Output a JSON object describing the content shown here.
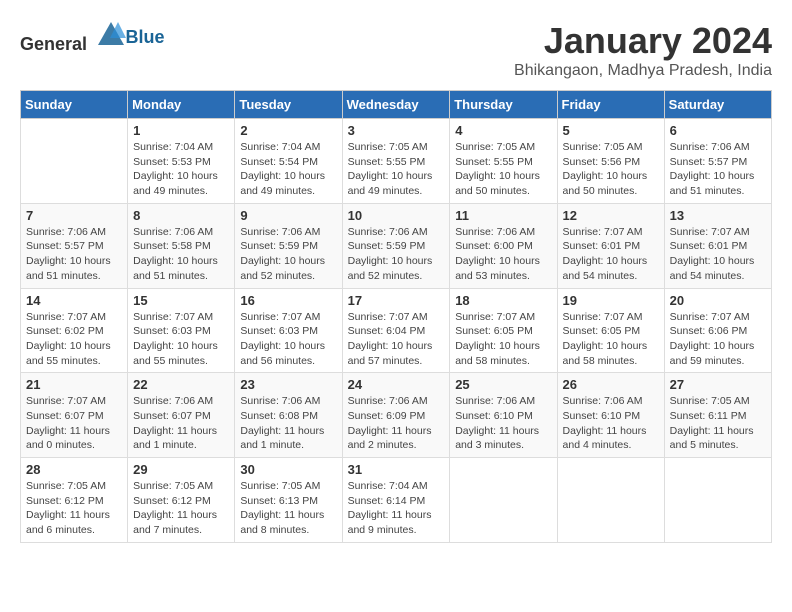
{
  "logo": {
    "general": "General",
    "blue": "Blue"
  },
  "header": {
    "title": "January 2024",
    "subtitle": "Bhikangaon, Madhya Pradesh, India"
  },
  "days_of_week": [
    "Sunday",
    "Monday",
    "Tuesday",
    "Wednesday",
    "Thursday",
    "Friday",
    "Saturday"
  ],
  "weeks": [
    [
      {
        "day": "",
        "info": ""
      },
      {
        "day": "1",
        "info": "Sunrise: 7:04 AM\nSunset: 5:53 PM\nDaylight: 10 hours\nand 49 minutes."
      },
      {
        "day": "2",
        "info": "Sunrise: 7:04 AM\nSunset: 5:54 PM\nDaylight: 10 hours\nand 49 minutes."
      },
      {
        "day": "3",
        "info": "Sunrise: 7:05 AM\nSunset: 5:55 PM\nDaylight: 10 hours\nand 49 minutes."
      },
      {
        "day": "4",
        "info": "Sunrise: 7:05 AM\nSunset: 5:55 PM\nDaylight: 10 hours\nand 50 minutes."
      },
      {
        "day": "5",
        "info": "Sunrise: 7:05 AM\nSunset: 5:56 PM\nDaylight: 10 hours\nand 50 minutes."
      },
      {
        "day": "6",
        "info": "Sunrise: 7:06 AM\nSunset: 5:57 PM\nDaylight: 10 hours\nand 51 minutes."
      }
    ],
    [
      {
        "day": "7",
        "info": "Sunrise: 7:06 AM\nSunset: 5:57 PM\nDaylight: 10 hours\nand 51 minutes."
      },
      {
        "day": "8",
        "info": "Sunrise: 7:06 AM\nSunset: 5:58 PM\nDaylight: 10 hours\nand 51 minutes."
      },
      {
        "day": "9",
        "info": "Sunrise: 7:06 AM\nSunset: 5:59 PM\nDaylight: 10 hours\nand 52 minutes."
      },
      {
        "day": "10",
        "info": "Sunrise: 7:06 AM\nSunset: 5:59 PM\nDaylight: 10 hours\nand 52 minutes."
      },
      {
        "day": "11",
        "info": "Sunrise: 7:06 AM\nSunset: 6:00 PM\nDaylight: 10 hours\nand 53 minutes."
      },
      {
        "day": "12",
        "info": "Sunrise: 7:07 AM\nSunset: 6:01 PM\nDaylight: 10 hours\nand 54 minutes."
      },
      {
        "day": "13",
        "info": "Sunrise: 7:07 AM\nSunset: 6:01 PM\nDaylight: 10 hours\nand 54 minutes."
      }
    ],
    [
      {
        "day": "14",
        "info": "Sunrise: 7:07 AM\nSunset: 6:02 PM\nDaylight: 10 hours\nand 55 minutes."
      },
      {
        "day": "15",
        "info": "Sunrise: 7:07 AM\nSunset: 6:03 PM\nDaylight: 10 hours\nand 55 minutes."
      },
      {
        "day": "16",
        "info": "Sunrise: 7:07 AM\nSunset: 6:03 PM\nDaylight: 10 hours\nand 56 minutes."
      },
      {
        "day": "17",
        "info": "Sunrise: 7:07 AM\nSunset: 6:04 PM\nDaylight: 10 hours\nand 57 minutes."
      },
      {
        "day": "18",
        "info": "Sunrise: 7:07 AM\nSunset: 6:05 PM\nDaylight: 10 hours\nand 58 minutes."
      },
      {
        "day": "19",
        "info": "Sunrise: 7:07 AM\nSunset: 6:05 PM\nDaylight: 10 hours\nand 58 minutes."
      },
      {
        "day": "20",
        "info": "Sunrise: 7:07 AM\nSunset: 6:06 PM\nDaylight: 10 hours\nand 59 minutes."
      }
    ],
    [
      {
        "day": "21",
        "info": "Sunrise: 7:07 AM\nSunset: 6:07 PM\nDaylight: 11 hours\nand 0 minutes."
      },
      {
        "day": "22",
        "info": "Sunrise: 7:06 AM\nSunset: 6:07 PM\nDaylight: 11 hours\nand 1 minute."
      },
      {
        "day": "23",
        "info": "Sunrise: 7:06 AM\nSunset: 6:08 PM\nDaylight: 11 hours\nand 1 minute."
      },
      {
        "day": "24",
        "info": "Sunrise: 7:06 AM\nSunset: 6:09 PM\nDaylight: 11 hours\nand 2 minutes."
      },
      {
        "day": "25",
        "info": "Sunrise: 7:06 AM\nSunset: 6:10 PM\nDaylight: 11 hours\nand 3 minutes."
      },
      {
        "day": "26",
        "info": "Sunrise: 7:06 AM\nSunset: 6:10 PM\nDaylight: 11 hours\nand 4 minutes."
      },
      {
        "day": "27",
        "info": "Sunrise: 7:05 AM\nSunset: 6:11 PM\nDaylight: 11 hours\nand 5 minutes."
      }
    ],
    [
      {
        "day": "28",
        "info": "Sunrise: 7:05 AM\nSunset: 6:12 PM\nDaylight: 11 hours\nand 6 minutes."
      },
      {
        "day": "29",
        "info": "Sunrise: 7:05 AM\nSunset: 6:12 PM\nDaylight: 11 hours\nand 7 minutes."
      },
      {
        "day": "30",
        "info": "Sunrise: 7:05 AM\nSunset: 6:13 PM\nDaylight: 11 hours\nand 8 minutes."
      },
      {
        "day": "31",
        "info": "Sunrise: 7:04 AM\nSunset: 6:14 PM\nDaylight: 11 hours\nand 9 minutes."
      },
      {
        "day": "",
        "info": ""
      },
      {
        "day": "",
        "info": ""
      },
      {
        "day": "",
        "info": ""
      }
    ]
  ]
}
